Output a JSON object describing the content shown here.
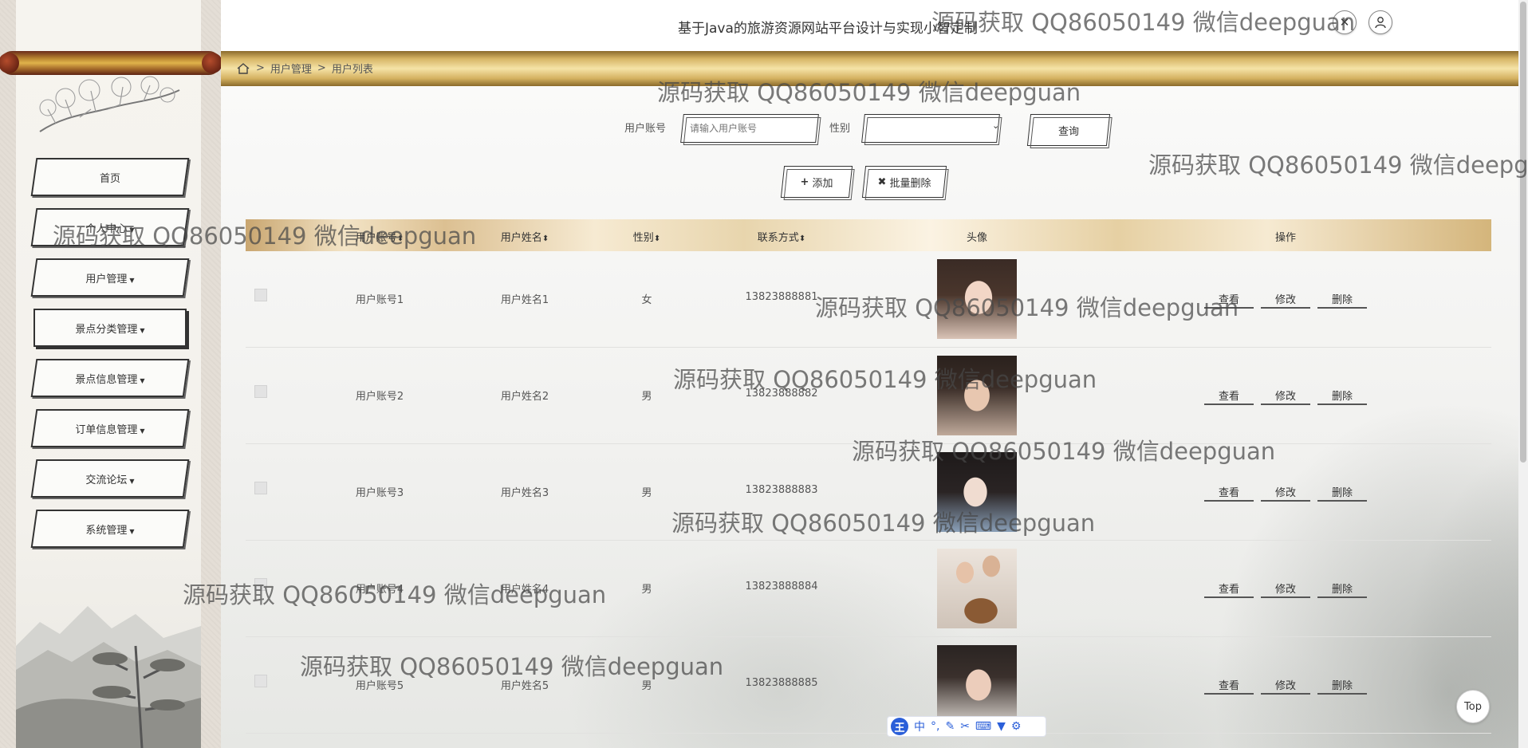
{
  "header": {
    "title": "基于Java的旅游资源网站平台设计与实现小智定制",
    "close_icon": "close-icon",
    "user_icon": "user-icon"
  },
  "breadcrumb": [
    "用户管理",
    "用户列表"
  ],
  "sidebar": {
    "items": [
      {
        "label": "首页",
        "has_caret": false
      },
      {
        "label": "个人中心",
        "has_caret": true
      },
      {
        "label": "用户管理",
        "has_caret": true
      },
      {
        "label": "景点分类管理",
        "has_caret": true
      },
      {
        "label": "景点信息管理",
        "has_caret": true
      },
      {
        "label": "订单信息管理",
        "has_caret": true
      },
      {
        "label": "交流论坛",
        "has_caret": true
      },
      {
        "label": "系统管理",
        "has_caret": true
      }
    ]
  },
  "search": {
    "account_label": "用户账号",
    "account_placeholder": "请输入用户账号",
    "gender_label": "性别",
    "gender_value": "",
    "query_button": "查询"
  },
  "actions": {
    "add_label": "添加",
    "batch_delete_label": "批量删除"
  },
  "table": {
    "columns": [
      "用户账号",
      "用户姓名",
      "性别",
      "联系方式",
      "头像",
      "操作"
    ],
    "rows": [
      {
        "account": "用户账号1",
        "name": "用户姓名1",
        "gender": "女",
        "phone": "13823888881"
      },
      {
        "account": "用户账号2",
        "name": "用户姓名2",
        "gender": "男",
        "phone": "13823888882"
      },
      {
        "account": "用户账号3",
        "name": "用户姓名3",
        "gender": "男",
        "phone": "13823888883"
      },
      {
        "account": "用户账号4",
        "name": "用户姓名4",
        "gender": "男",
        "phone": "13823888884"
      },
      {
        "account": "用户账号5",
        "name": "用户姓名5",
        "gender": "男",
        "phone": "13823888885"
      }
    ],
    "row_actions": [
      "查看",
      "修改",
      "删除"
    ]
  },
  "watermark": "源码获取 QQ86050149 微信deepguan",
  "back_to_top": "Top",
  "ime_toolbar": {
    "logo": "王",
    "mode": "中"
  },
  "colors": {
    "gold": "#d7b565",
    "text": "#555555",
    "accent": "#2b5fd9"
  }
}
